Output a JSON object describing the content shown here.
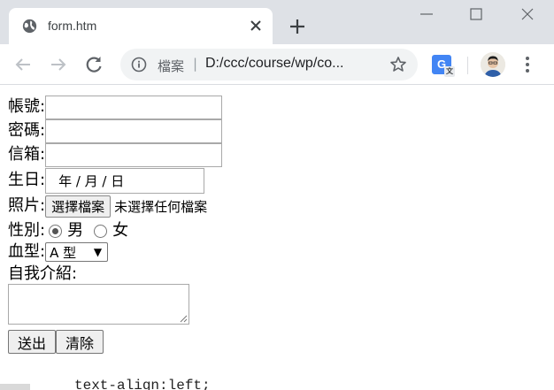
{
  "browser": {
    "tab_title": "form.htm",
    "omnibox_label": "檔案",
    "omnibox_separator": "|",
    "url": "D:/ccc/course/wp/co...",
    "extension_translate": "G",
    "extension_translate_sub": "文"
  },
  "form": {
    "account_label": "帳號:",
    "password_label": "密碼:",
    "email_label": "信箱:",
    "birthday_label": "生日:",
    "birthday_placeholder": "年 / 月 / 日",
    "photo_label": "照片:",
    "file_button": "選擇檔案",
    "file_status": "未選擇任何檔案",
    "gender_label": "性別:",
    "gender_male": "男",
    "gender_female": "女",
    "gender_selected": "男",
    "blood_label": "血型:",
    "blood_selected": "A 型",
    "intro_label": "自我介紹:",
    "submit_label": "送出",
    "reset_label": "清除"
  },
  "overflow_text": "text-align:left;",
  "colors": {
    "tabstrip_bg": "#dee1e6",
    "omnibox_bg": "#f1f3f4",
    "translate_blue": "#4285f4"
  }
}
